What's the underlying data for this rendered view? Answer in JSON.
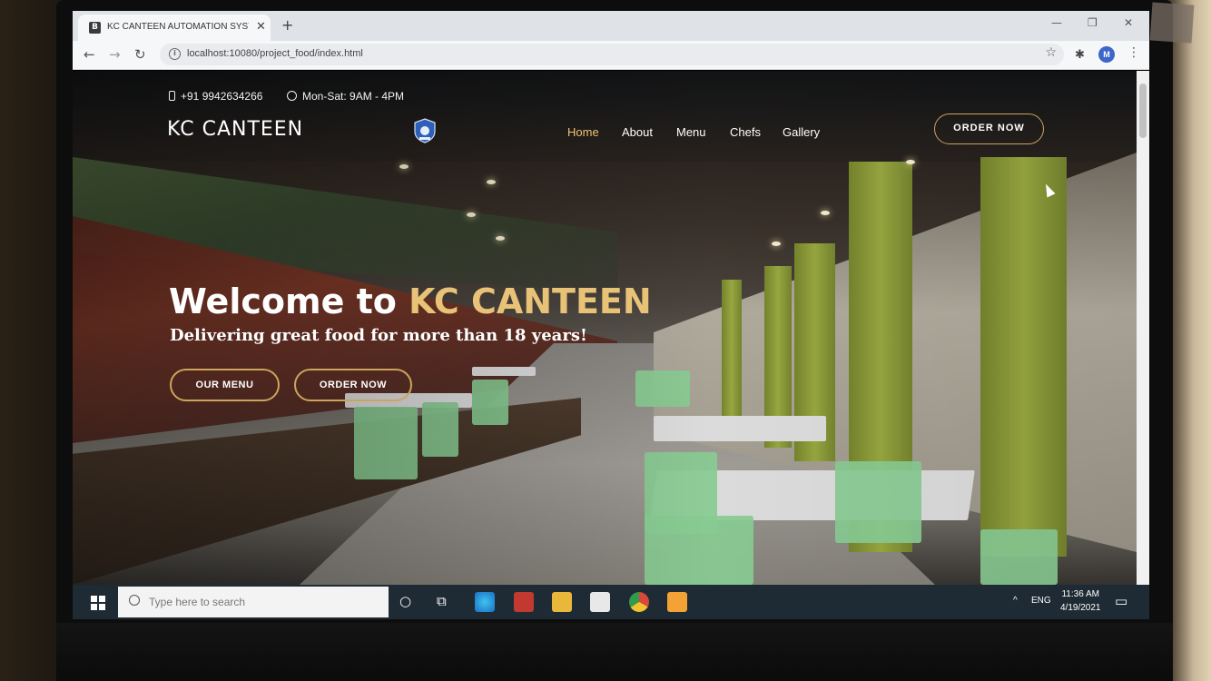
{
  "browser": {
    "tab_title": "KC CANTEEN AUTOMATION SYSTEM",
    "url": "localhost:10080/project_food/index.html",
    "profile_initial": "M"
  },
  "site": {
    "phone": "+91 9942634266",
    "hours": "Mon-Sat: 9AM - 4PM",
    "logo": "KC CANTEEN",
    "nav": [
      {
        "label": "Home",
        "active": true
      },
      {
        "label": "About"
      },
      {
        "label": "Menu"
      },
      {
        "label": "Chefs"
      },
      {
        "label": "Gallery"
      }
    ],
    "order_button": "ORDER NOW",
    "hero": {
      "title_prefix": "Welcome to ",
      "title_accent": "KC CANTEEN",
      "subtitle": "Delivering great food for more than 18 years!",
      "menu_button": "OUR MENU",
      "order_button": "ORDER NOW"
    },
    "colors": {
      "accent": "#cda45e",
      "active_nav": "#f2c471"
    }
  },
  "taskbar": {
    "search_placeholder": "Type here to search",
    "language": "ENG",
    "time": "11:36 AM",
    "date": "4/19/2021"
  }
}
